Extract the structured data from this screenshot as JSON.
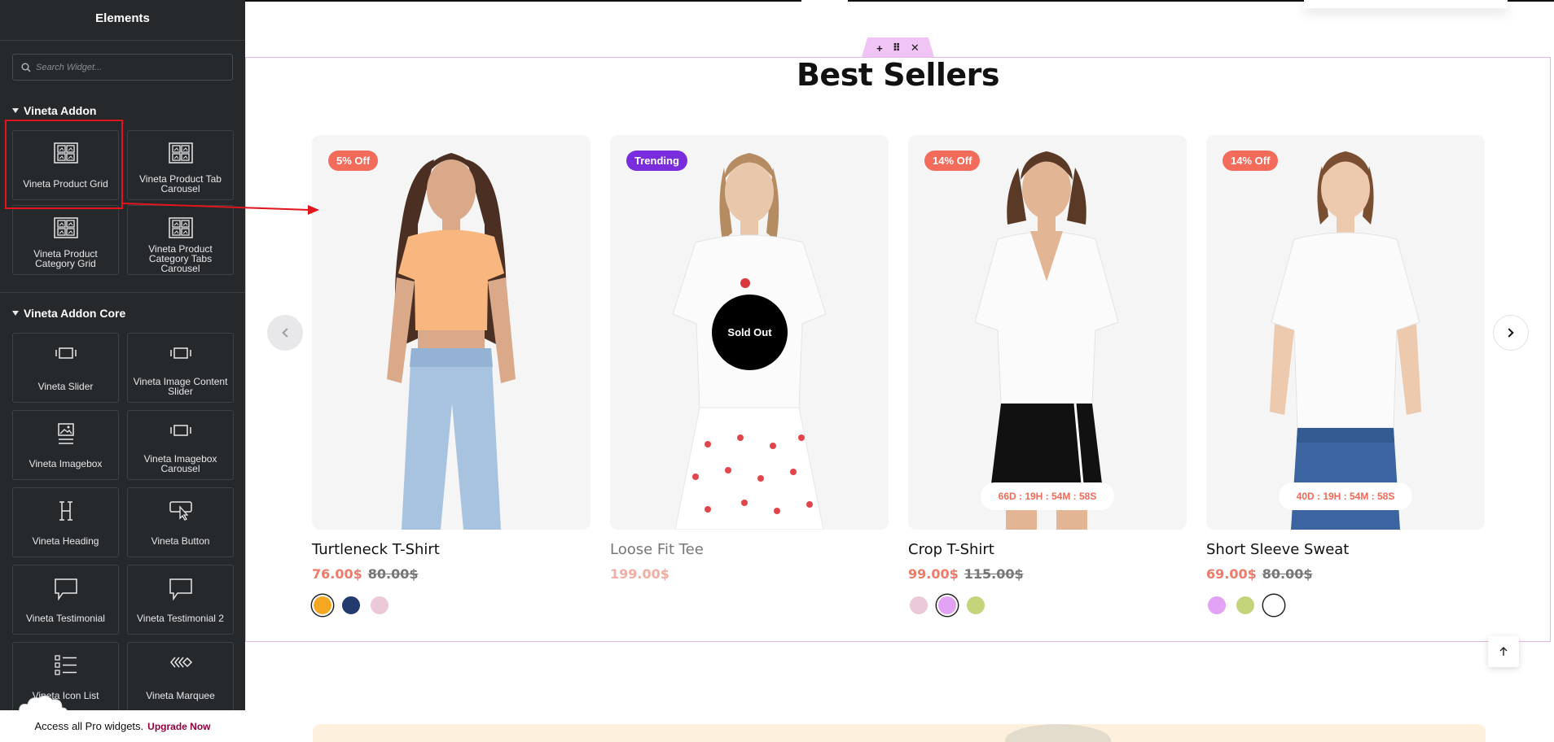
{
  "sidebar": {
    "title": "Elements",
    "search_placeholder": "Search Widget...",
    "categories": [
      {
        "name": "Vineta Addon",
        "widgets": [
          {
            "label": "Vineta Product Grid",
            "icon": "product-grid-icon"
          },
          {
            "label": "Vineta Product Tab Carousel",
            "icon": "product-grid-icon"
          },
          {
            "label": "Vineta Product Category Grid",
            "icon": "product-grid-icon"
          },
          {
            "label": "Vineta Product Category Tabs Carousel",
            "icon": "product-grid-icon"
          }
        ]
      },
      {
        "name": "Vineta Addon Core",
        "widgets": [
          {
            "label": "Vineta Slider",
            "icon": "slider-icon"
          },
          {
            "label": "Vineta Image Content Slider",
            "icon": "slider-icon"
          },
          {
            "label": "Vineta Imagebox",
            "icon": "image-icon"
          },
          {
            "label": "Vineta Imagebox Carousel",
            "icon": "slider-icon"
          },
          {
            "label": "Vineta Heading",
            "icon": "heading-icon"
          },
          {
            "label": "Vineta Button",
            "icon": "button-pointer-icon"
          },
          {
            "label": "Vineta Testimonial",
            "icon": "speech-bubble-icon"
          },
          {
            "label": "Vineta Testimonial 2",
            "icon": "speech-bubble-icon"
          },
          {
            "label": "Vineta Icon List",
            "icon": "list-icon"
          },
          {
            "label": "Vineta Marquee",
            "icon": "marquee-icon"
          }
        ]
      }
    ],
    "pro_text": "Access all Pro widgets.",
    "upgrade_label": "Upgrade Now"
  },
  "section": {
    "title": "Best Sellers",
    "handle_buttons": [
      "+",
      "⠿",
      "✕"
    ]
  },
  "products": [
    {
      "name": "Turtleneck T-Shirt",
      "badge": "5% Off",
      "badge_color": "#f26b5b",
      "price": "76.00$",
      "old_price": "80.00$",
      "sold_out": "",
      "countdown": "",
      "swatches": [
        "#f5a623",
        "#233a6e",
        "#ecc9d8"
      ],
      "selected_swatch": 0,
      "muted": false
    },
    {
      "name": "Loose Fit Tee",
      "badge": "Trending",
      "badge_color": "#7a2ddc",
      "price": "199.00$",
      "old_price": "",
      "sold_out": "Sold Out",
      "countdown": "",
      "swatches": [],
      "selected_swatch": -1,
      "muted": true
    },
    {
      "name": "Crop T-Shirt",
      "badge": "14% Off",
      "badge_color": "#f26b5b",
      "price": "99.00$",
      "old_price": "115.00$",
      "sold_out": "",
      "countdown": "66D : 19H : 54M : 58S",
      "swatches": [
        "#ecc9d8",
        "#e2a3f5",
        "#c4d47b"
      ],
      "selected_swatch": 1,
      "muted": false
    },
    {
      "name": "Short Sleeve Sweat",
      "badge": "14% Off",
      "badge_color": "#f26b5b",
      "price": "69.00$",
      "old_price": "80.00$",
      "sold_out": "",
      "countdown": "40D : 19H : 54M : 58S",
      "swatches": [
        "#e2a3f5",
        "#c4d47b",
        "#ffffff"
      ],
      "selected_swatch": 2,
      "muted": false
    }
  ],
  "colors": {
    "sidebar_bg": "#26292c",
    "accent_sale": "#f07a6a",
    "highlight_red": "#e0161c",
    "section_outline": "#e6b7e6",
    "upgrade": "#93003f"
  }
}
